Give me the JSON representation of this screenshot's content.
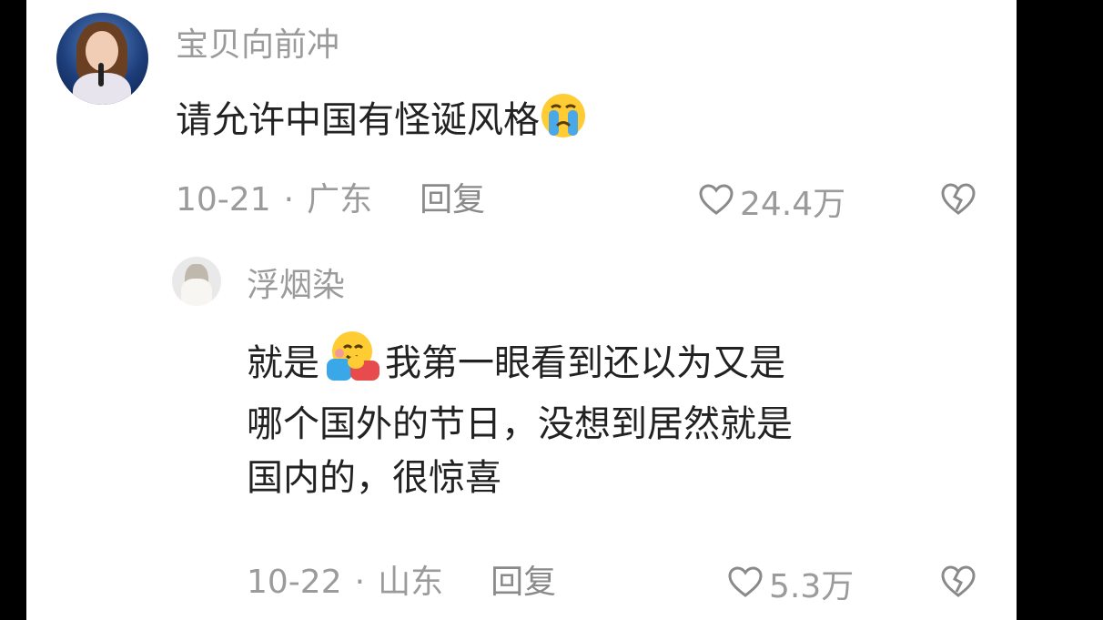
{
  "comments": [
    {
      "username": "宝贝向前冲",
      "text": "请允许中国有怪诞风格",
      "emoji": "crying-face",
      "date": "10-21",
      "location": "广东",
      "reply_label": "回复",
      "likes": "24.4万"
    },
    {
      "username": "浮烟染",
      "text_line1_a": "就是",
      "emoji": "hugging-face",
      "text_line1_b": "我第一眼看到还以为又是",
      "text_line2": "哪个国外的节日，没想到居然就是",
      "text_line3": "国内的，很惊喜",
      "date": "10-22",
      "location": "山东",
      "reply_label": "回复",
      "likes": "5.3万"
    }
  ],
  "separator": "·"
}
